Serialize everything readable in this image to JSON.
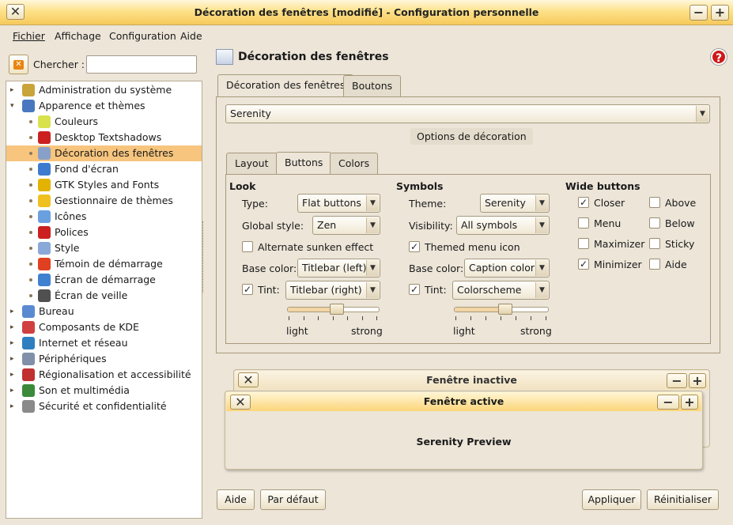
{
  "window": {
    "title": "Décoration des fenêtres [modifié] - Configuration personnelle",
    "close": "✕",
    "minimize": "−",
    "maximize": "+"
  },
  "menubar": [
    {
      "label": "Fichier"
    },
    {
      "label": "Affichage"
    },
    {
      "label": "Configuration"
    },
    {
      "label": "Aide"
    }
  ],
  "search": {
    "label": "Chercher :",
    "value": "",
    "placeholder": ""
  },
  "tree": [
    {
      "label": "Administration du système",
      "level": 0,
      "expander": "▸",
      "icon": "admin-icon",
      "color": "#c9a43a"
    },
    {
      "label": "Apparence et thèmes",
      "level": 0,
      "expander": "▾",
      "icon": "appearance-icon",
      "color": "#4a78c0"
    },
    {
      "label": "Couleurs",
      "level": 1,
      "icon": "colors-icon",
      "color": "#d9e24c"
    },
    {
      "label": "Desktop Textshadows",
      "level": 1,
      "icon": "fonts-icon",
      "color": "#cc2020"
    },
    {
      "label": "Décoration des fenêtres",
      "level": 1,
      "icon": "window-decoration-icon",
      "color": "#88a0c8",
      "selected": true
    },
    {
      "label": "Fond d'écran",
      "level": 1,
      "icon": "wallpaper-icon",
      "color": "#3d7bd0"
    },
    {
      "label": "GTK Styles and Fonts",
      "level": 1,
      "icon": "gtk-icon",
      "color": "#e2b300"
    },
    {
      "label": "Gestionnaire de thèmes",
      "level": 1,
      "icon": "theme-manager-icon",
      "color": "#f0c020"
    },
    {
      "label": "Icônes",
      "level": 1,
      "icon": "icons-icon",
      "color": "#6aa0e0"
    },
    {
      "label": "Polices",
      "level": 1,
      "icon": "fonts-icon",
      "color": "#cc2020"
    },
    {
      "label": "Style",
      "level": 1,
      "icon": "style-icon",
      "color": "#8aa8d8"
    },
    {
      "label": "Témoin de démarrage",
      "level": 1,
      "icon": "launch-feedback-icon",
      "color": "#e04020"
    },
    {
      "label": "Écran de démarrage",
      "level": 1,
      "icon": "splash-icon",
      "color": "#4080d0"
    },
    {
      "label": "Écran de veille",
      "level": 1,
      "icon": "screensaver-icon",
      "color": "#505050"
    },
    {
      "label": "Bureau",
      "level": 0,
      "expander": "▸",
      "icon": "desktop-icon",
      "color": "#5a8ad0"
    },
    {
      "label": "Composants de KDE",
      "level": 0,
      "expander": "▸",
      "icon": "kde-components-icon",
      "color": "#d04040"
    },
    {
      "label": "Internet et réseau",
      "level": 0,
      "expander": "▸",
      "icon": "network-icon",
      "color": "#2f7fc0"
    },
    {
      "label": "Périphériques",
      "level": 0,
      "expander": "▸",
      "icon": "peripherals-icon",
      "color": "#8090a8"
    },
    {
      "label": "Régionalisation et accessibilité",
      "level": 0,
      "expander": "▸",
      "icon": "regional-icon",
      "color": "#c03030"
    },
    {
      "label": "Son et multimédia",
      "level": 0,
      "expander": "▸",
      "icon": "sound-icon",
      "color": "#3a8a3a"
    },
    {
      "label": "Sécurité et confidentialité",
      "level": 0,
      "expander": "▸",
      "icon": "security-icon",
      "color": "#8a8a8a"
    }
  ],
  "panel": {
    "title": "Décoration des fenêtres",
    "help": "?",
    "tabs": [
      {
        "label": "Décoration des fenêtres"
      },
      {
        "label": "Boutons"
      }
    ],
    "decoration_combo": "Serenity",
    "options_label": "Options de décoration",
    "subtabs": [
      {
        "label": "Layout"
      },
      {
        "label": "Buttons"
      },
      {
        "label": "Colors"
      }
    ],
    "look": {
      "heading": "Look",
      "type_label": "Type:",
      "type_value": "Flat buttons",
      "global_style_label": "Global style:",
      "global_style_value": "Zen",
      "alternate_sunken_label": "Alternate sunken effect",
      "alternate_sunken_checked": false,
      "base_color_label": "Base color:",
      "base_color_value": "Titlebar (left)",
      "tint_label": "Tint:",
      "tint_checked": true,
      "tint_value": "Titlebar (right)",
      "tint_strength": 0.55,
      "light_label": "light",
      "strong_label": "strong"
    },
    "symbols": {
      "heading": "Symbols",
      "theme_label": "Theme:",
      "theme_value": "Serenity",
      "visibility_label": "Visibility:",
      "visibility_value": "All symbols",
      "themed_menu_label": "Themed menu icon",
      "themed_menu_checked": true,
      "base_color_label": "Base color:",
      "base_color_value": "Caption color",
      "tint_label": "Tint:",
      "tint_checked": true,
      "tint_value": "Colorscheme",
      "tint_strength": 0.55,
      "light_label": "light",
      "strong_label": "strong"
    },
    "wide_buttons": {
      "heading": "Wide buttons",
      "items": [
        {
          "label": "Closer",
          "checked": true
        },
        {
          "label": "Above",
          "checked": false
        },
        {
          "label": "Menu",
          "checked": false
        },
        {
          "label": "Below",
          "checked": false
        },
        {
          "label": "Maximizer",
          "checked": false
        },
        {
          "label": "Sticky",
          "checked": false
        },
        {
          "label": "Minimizer",
          "checked": true
        },
        {
          "label": "Aide",
          "checked": false
        }
      ]
    },
    "preview": {
      "inactive_title": "Fenêtre inactive",
      "active_title": "Fenêtre active",
      "body_text": "Serenity Preview"
    }
  },
  "buttons": {
    "help": "Aide",
    "defaults": "Par défaut",
    "apply": "Appliquer",
    "reset": "Réinitialiser"
  },
  "colors": {
    "accent": "#f7c57e",
    "titlebar": "#fbd57a",
    "background": "#ece5d8"
  }
}
